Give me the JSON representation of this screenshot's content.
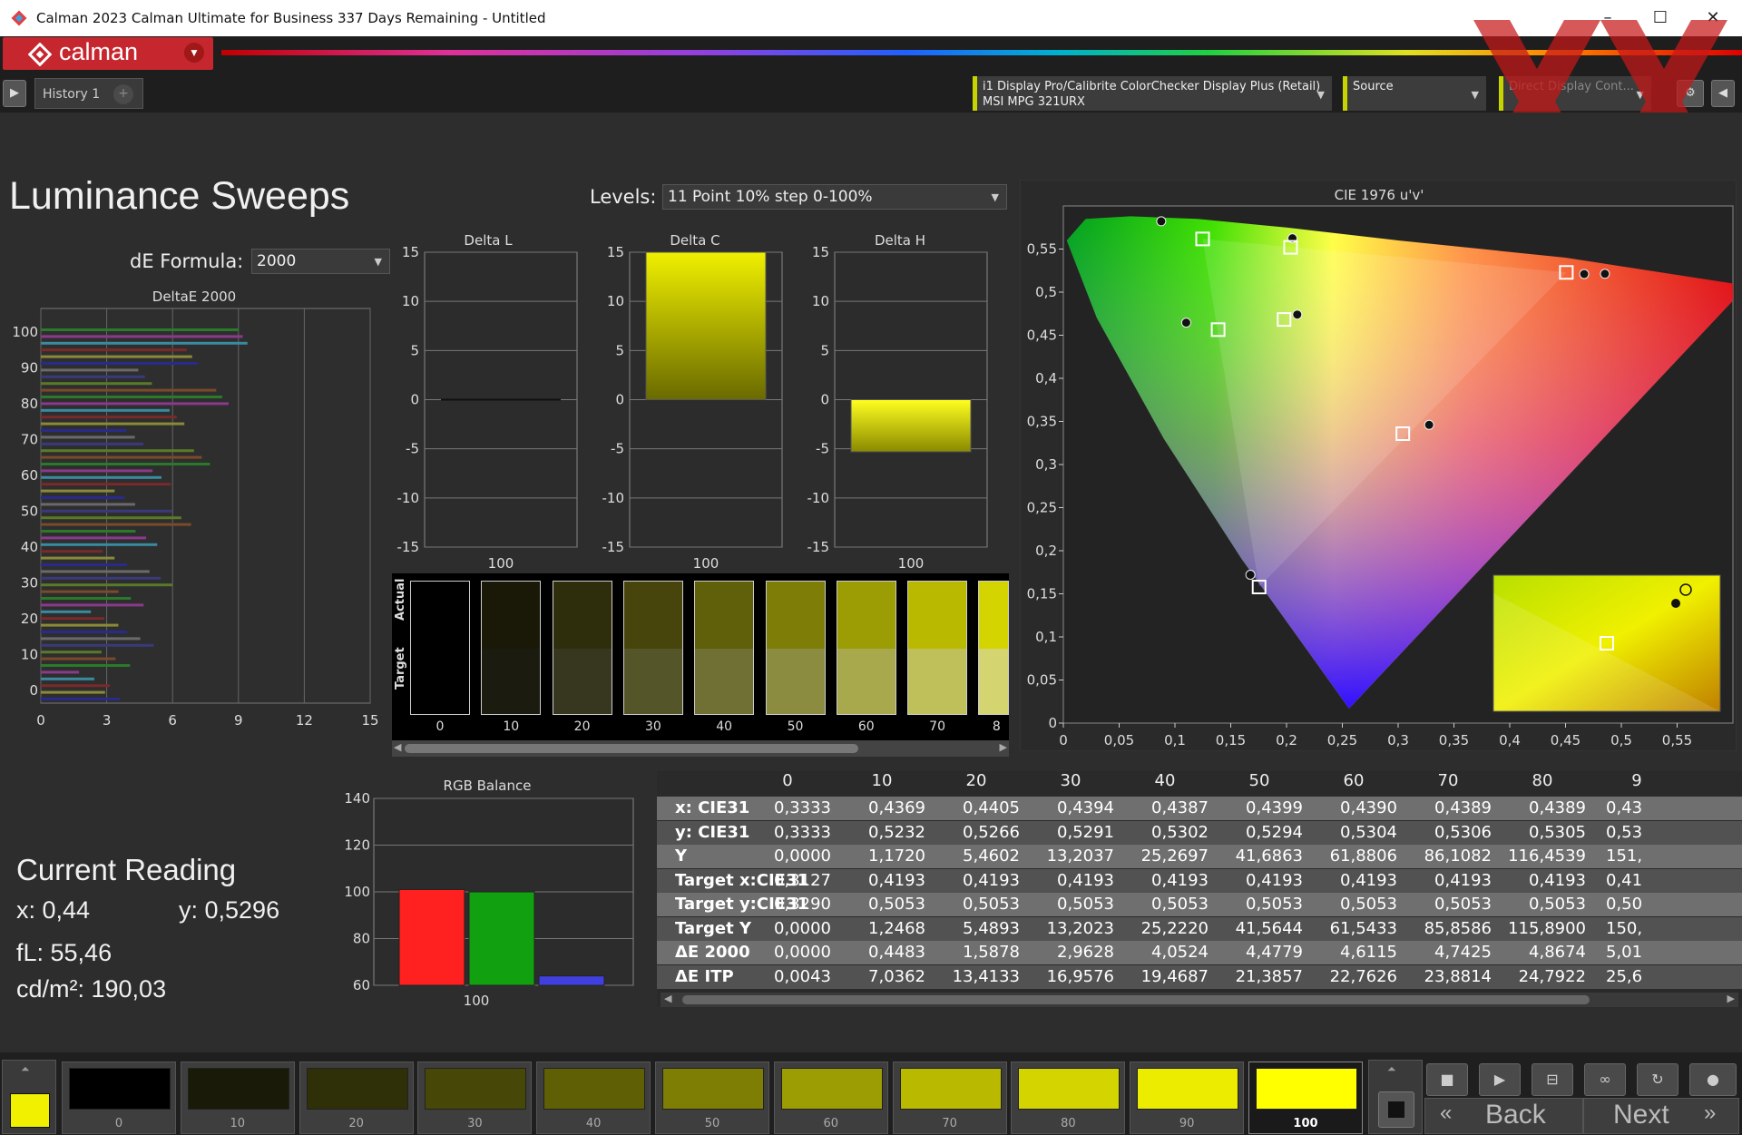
{
  "window": {
    "title": "Calman 2023 Calman Ultimate for Business 337 Days Remaining  - Untitled"
  },
  "brand": {
    "logo": "calman"
  },
  "tabs": [
    {
      "label": "History 1"
    }
  ],
  "devices": {
    "meter_line1": "i1 Display Pro/Calibrite ColorChecker Display Plus (Retail)",
    "meter_line2": "MSI MPG 321URX",
    "source": "Source",
    "display_control": "Direct Display Cont..."
  },
  "page": {
    "title": "Luminance Sweeps",
    "levels_label": "Levels:",
    "levels_value": "11 Point 10% step 0-100%",
    "de_formula_label": "dE Formula:",
    "de_formula_value": "2000"
  },
  "colors": {
    "accent_yellow": "#f0f000",
    "brand_red": "#c6262e",
    "red": "#ff2020",
    "green": "#10a010",
    "blue": "#4040e0"
  },
  "chart_data": [
    {
      "type": "bar",
      "title": "DeltaE 2000",
      "orientation": "horizontal",
      "x_ticks": [
        "0",
        "3",
        "6",
        "9",
        "12",
        "15"
      ],
      "y_ticks": [
        "0",
        "10",
        "20",
        "30",
        "40",
        "50",
        "60",
        "70",
        "80",
        "90",
        "100"
      ],
      "xlim": [
        0,
        15
      ],
      "ylim": [
        0,
        100
      ],
      "grid": true
    },
    {
      "type": "bar",
      "title": "Delta L",
      "categories": [
        "100"
      ],
      "values": [
        0
      ],
      "ylim": [
        -15,
        15
      ],
      "y_ticks": [
        "15",
        "10",
        "5",
        "0",
        "-5",
        "-10",
        "-15"
      ]
    },
    {
      "type": "bar",
      "title": "Delta C",
      "categories": [
        "100"
      ],
      "values": [
        15
      ],
      "ylim": [
        -15,
        15
      ],
      "y_ticks": [
        "15",
        "10",
        "5",
        "0",
        "-5",
        "-10",
        "-15"
      ]
    },
    {
      "type": "bar",
      "title": "Delta H",
      "categories": [
        "100"
      ],
      "values": [
        -5.3
      ],
      "ylim": [
        -15,
        15
      ],
      "y_ticks": [
        "15",
        "10",
        "5",
        "0",
        "-5",
        "-10",
        "-15"
      ]
    },
    {
      "type": "bar",
      "title": "RGB Balance",
      "categories": [
        "100"
      ],
      "series": [
        {
          "name": "R",
          "values": [
            101
          ]
        },
        {
          "name": "G",
          "values": [
            100
          ]
        },
        {
          "name": "B",
          "values": [
            64
          ]
        }
      ],
      "ylim": [
        60,
        140
      ],
      "y_ticks": [
        "140",
        "120",
        "100",
        "80",
        "60"
      ]
    },
    {
      "type": "scatter",
      "title": "CIE 1976 u'v'",
      "x_ticks": [
        "0",
        "0,05",
        "0,1",
        "0,15",
        "0,2",
        "0,25",
        "0,3",
        "0,35",
        "0,4",
        "0,45",
        "0,5",
        "0,55"
      ],
      "y_ticks": [
        "0,55",
        "0,5",
        "0,45",
        "0,4",
        "0,35",
        "0,3",
        "0,25",
        "0,2",
        "0,15",
        "0,1",
        "0,05",
        "0"
      ],
      "xlim": [
        0,
        0.6
      ],
      "ylim": [
        0,
        0.6
      ],
      "targets": [
        {
          "u": 0.1248,
          "v": 0.5617
        },
        {
          "u": 0.2036,
          "v": 0.552
        },
        {
          "u": 0.4507,
          "v": 0.5229
        },
        {
          "u": 0.1387,
          "v": 0.4565
        },
        {
          "u": 0.1978,
          "v": 0.4683
        },
        {
          "u": 0.3042,
          "v": 0.3358
        },
        {
          "u": 0.1754,
          "v": 0.1579
        }
      ],
      "measured": [
        {
          "u": 0.0877,
          "v": 0.5822
        },
        {
          "u": 0.2053,
          "v": 0.5625
        },
        {
          "u": 0.4853,
          "v": 0.5213
        },
        {
          "u": 0.4667,
          "v": 0.521
        },
        {
          "u": 0.1101,
          "v": 0.4646
        },
        {
          "u": 0.2096,
          "v": 0.474
        },
        {
          "u": 0.3278,
          "v": 0.346
        },
        {
          "u": 0.1676,
          "v": 0.1721
        }
      ]
    }
  ],
  "swatch_strip": {
    "row_labels": [
      "Actual",
      "Target"
    ],
    "levels": [
      "0",
      "10",
      "20",
      "30",
      "40",
      "50",
      "60",
      "70",
      "8"
    ]
  },
  "current_reading": {
    "title": "Current Reading",
    "x": "x: 0,44",
    "y": "y: 0,5296",
    "fl": "fL: 55,46",
    "cdm2": "cd/m²: 190,03"
  },
  "table": {
    "columns": [
      "0",
      "10",
      "20",
      "30",
      "40",
      "50",
      "60",
      "70",
      "80",
      "9"
    ],
    "rows": [
      {
        "label": "x: CIE31",
        "values": [
          "0,3333",
          "0,4369",
          "0,4405",
          "0,4394",
          "0,4387",
          "0,4399",
          "0,4390",
          "0,4389",
          "0,4389",
          "0,43"
        ]
      },
      {
        "label": "y: CIE31",
        "values": [
          "0,3333",
          "0,5232",
          "0,5266",
          "0,5291",
          "0,5302",
          "0,5294",
          "0,5304",
          "0,5306",
          "0,5305",
          "0,53"
        ]
      },
      {
        "label": "Y",
        "values": [
          "0,0000",
          "1,1720",
          "5,4602",
          "13,2037",
          "25,2697",
          "41,6863",
          "61,8806",
          "86,1082",
          "116,4539",
          "151,"
        ]
      },
      {
        "label": "Target x:CIE31",
        "values": [
          "0,3127",
          "0,4193",
          "0,4193",
          "0,4193",
          "0,4193",
          "0,4193",
          "0,4193",
          "0,4193",
          "0,4193",
          "0,41"
        ]
      },
      {
        "label": "Target y:CIE31",
        "values": [
          "0,3290",
          "0,5053",
          "0,5053",
          "0,5053",
          "0,5053",
          "0,5053",
          "0,5053",
          "0,5053",
          "0,5053",
          "0,50"
        ]
      },
      {
        "label": "Target Y",
        "values": [
          "0,0000",
          "1,2468",
          "5,4893",
          "13,2023",
          "25,2220",
          "41,5644",
          "61,5433",
          "85,8586",
          "115,8900",
          "150,"
        ]
      },
      {
        "label": "ΔE 2000",
        "values": [
          "0,0000",
          "0,4483",
          "1,5878",
          "2,9628",
          "4,0524",
          "4,4779",
          "4,6115",
          "4,7425",
          "4,8674",
          "5,01"
        ]
      },
      {
        "label": "ΔE ITP",
        "values": [
          "0,0043",
          "7,0362",
          "13,4133",
          "16,9576",
          "19,4687",
          "21,3857",
          "22,7626",
          "23,8814",
          "24,7922",
          "25,6"
        ]
      }
    ]
  },
  "bottom_swatches": [
    {
      "label": "0",
      "color": "#000000"
    },
    {
      "label": "10",
      "color": "#1a1a08"
    },
    {
      "label": "20",
      "color": "#2f2f08"
    },
    {
      "label": "30",
      "color": "#474708"
    },
    {
      "label": "40",
      "color": "#5f5f05"
    },
    {
      "label": "50",
      "color": "#7e7e05"
    },
    {
      "label": "60",
      "color": "#9c9c03"
    },
    {
      "label": "70",
      "color": "#b9b900"
    },
    {
      "label": "80",
      "color": "#d4d400"
    },
    {
      "label": "90",
      "color": "#ecec00"
    },
    {
      "label": "100",
      "color": "#ffff00"
    }
  ],
  "nav": {
    "back": "Back",
    "next": "Next"
  }
}
